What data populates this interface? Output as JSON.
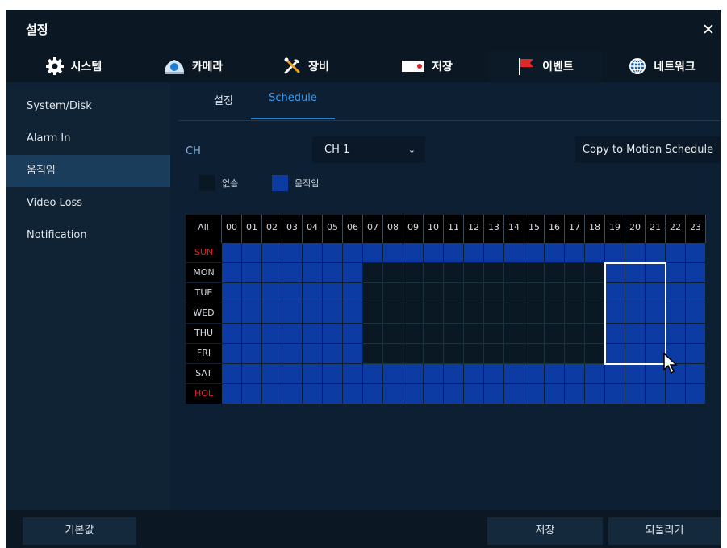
{
  "window": {
    "title": "설정"
  },
  "tabs": [
    {
      "label": "시스템",
      "icon": "gear-icon"
    },
    {
      "label": "카메라",
      "icon": "camera-icon"
    },
    {
      "label": "장비",
      "icon": "tools-icon"
    },
    {
      "label": "저장",
      "icon": "recorder-icon"
    },
    {
      "label": "이벤트",
      "icon": "flag-icon",
      "active": true
    },
    {
      "label": "네트워크",
      "icon": "globe-icon"
    }
  ],
  "sidebar": {
    "items": [
      {
        "label": "System/Disk"
      },
      {
        "label": "Alarm In"
      },
      {
        "label": "움직임",
        "active": true
      },
      {
        "label": "Video Loss"
      },
      {
        "label": "Notification"
      }
    ]
  },
  "subtabs": [
    {
      "label": "설정"
    },
    {
      "label": "Schedule",
      "active": true
    }
  ],
  "channel": {
    "label": "CH",
    "selected": "CH 1"
  },
  "copy_button": "Copy to Motion Schedule",
  "legend": [
    {
      "label": "없슴",
      "color": "#0a1824"
    },
    {
      "label": "움직임",
      "color": "#0b3ba3"
    }
  ],
  "schedule": {
    "all_label": "All",
    "hours": [
      "00",
      "01",
      "02",
      "03",
      "04",
      "05",
      "06",
      "07",
      "08",
      "09",
      "10",
      "11",
      "12",
      "13",
      "14",
      "15",
      "16",
      "17",
      "18",
      "19",
      "20",
      "21",
      "22",
      "23"
    ],
    "days": [
      {
        "label": "SUN",
        "color": "#e02020",
        "slots": "111111111111111111111111"
      },
      {
        "label": "MON",
        "color": "#d8dde3",
        "slots": "111111100000000000011111"
      },
      {
        "label": "TUE",
        "color": "#d8dde3",
        "slots": "111111100000000000011111"
      },
      {
        "label": "WED",
        "color": "#d8dde3",
        "slots": "111111100000000000011111"
      },
      {
        "label": "THU",
        "color": "#d8dde3",
        "slots": "111111100000000000011111"
      },
      {
        "label": "FRI",
        "color": "#d8dde3",
        "slots": "111111100000000000011111"
      },
      {
        "label": "SAT",
        "color": "#d8dde3",
        "slots": "111111111111111111111111"
      },
      {
        "label": "HOL",
        "color": "#e02020",
        "slots": "111111111111111111111111"
      }
    ],
    "selection": {
      "from_hour": "19",
      "to_hour": "21",
      "from_day": "MON",
      "to_day": "FRI"
    }
  },
  "footer": {
    "default_label": "기본값",
    "save_label": "저장",
    "revert_label": "되돌리기"
  },
  "colors": {
    "active_blue": "#0b3ba3",
    "accent": "#1e7fd2",
    "holiday_red": "#e02020"
  }
}
